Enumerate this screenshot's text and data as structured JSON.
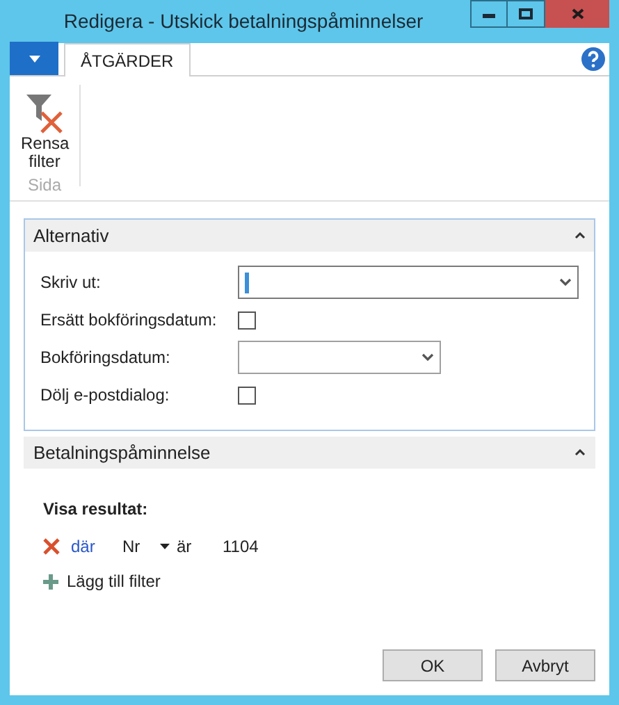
{
  "window": {
    "title": "Redigera - Utskick betalningspåminnelser"
  },
  "tabs": [
    {
      "label": "ÅTGÄRDER",
      "selected": true
    }
  ],
  "ribbon": {
    "actions": [
      {
        "label": "Rensa filter"
      }
    ],
    "group_label": "Sida"
  },
  "sections": [
    {
      "title": "Alternativ",
      "expanded": true,
      "fields": [
        {
          "label": "Skriv ut:",
          "kind": "dropdown",
          "focused": true
        },
        {
          "label": "Ersätt bokföringsdatum:",
          "kind": "checkbox",
          "checked": false
        },
        {
          "label": "Bokföringsdatum:",
          "kind": "date_dropdown",
          "focused": false
        },
        {
          "label": "Dölj e-postdialog:",
          "kind": "checkbox",
          "checked": false
        }
      ]
    },
    {
      "title": "Betalningspåminnelse",
      "expanded": true,
      "filter": {
        "heading": "Visa resultat:",
        "rows": [
          {
            "connector": "där",
            "field": "Nr",
            "operator": "är",
            "value": "1104"
          }
        ],
        "add_label": "Lägg till filter"
      }
    }
  ],
  "buttons": [
    "OK",
    "Avbryt"
  ]
}
